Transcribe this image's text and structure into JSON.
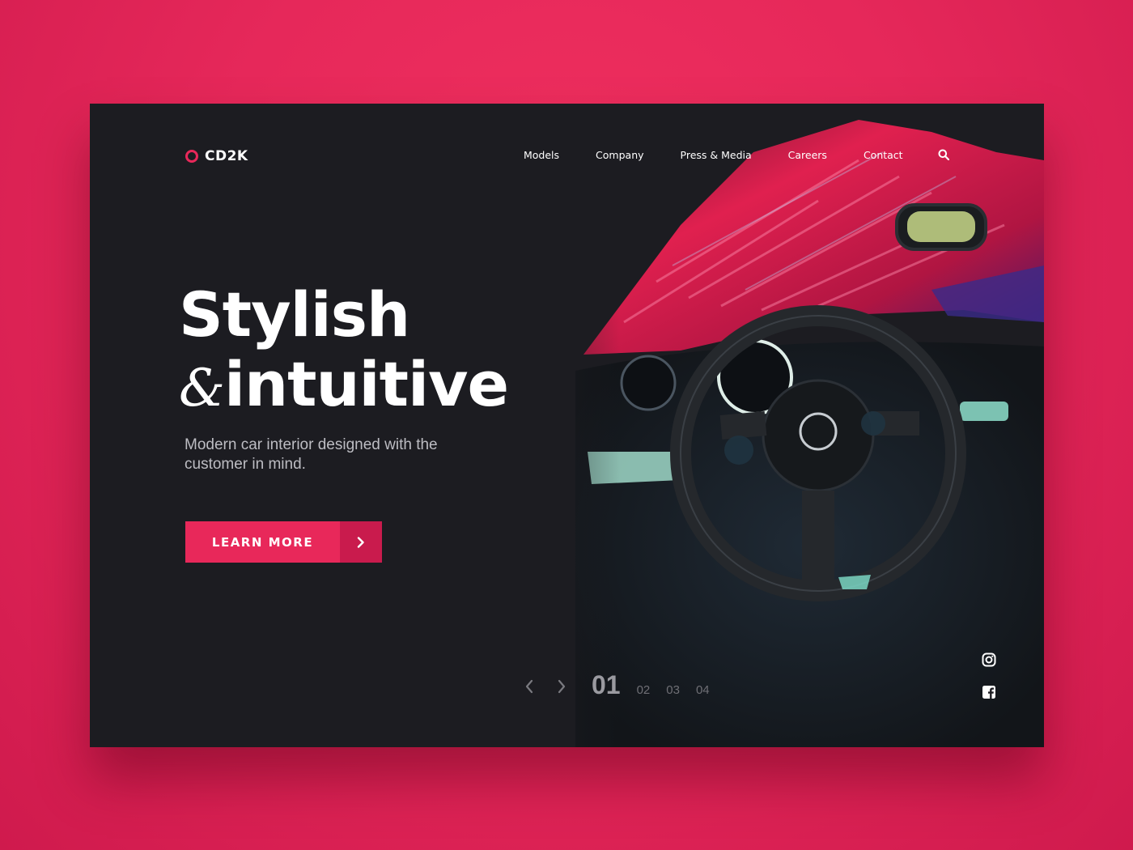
{
  "brand": {
    "name": "CD2K",
    "accent_color": "#e8285a"
  },
  "nav": {
    "items": [
      {
        "label": "Models"
      },
      {
        "label": "Company"
      },
      {
        "label": "Press & Media"
      },
      {
        "label": "Careers"
      },
      {
        "label": "Contact"
      }
    ],
    "search_icon": "search-icon"
  },
  "hero": {
    "title_line1": "Stylish",
    "title_amp": "&",
    "title_line2": "intuitive",
    "subtitle": "Modern car interior designed with the customer in mind.",
    "cta_label": "LEARN MORE",
    "cta_icon": "chevron-right-icon",
    "image_subject": "car-interior-steering-wheel"
  },
  "pager": {
    "prev_icon": "chevron-left-icon",
    "next_icon": "chevron-right-icon",
    "pages": [
      {
        "label": "01",
        "active": true
      },
      {
        "label": "02",
        "active": false
      },
      {
        "label": "03",
        "active": false
      },
      {
        "label": "04",
        "active": false
      }
    ]
  },
  "social": [
    {
      "icon": "instagram-icon"
    },
    {
      "icon": "facebook-icon"
    }
  ]
}
